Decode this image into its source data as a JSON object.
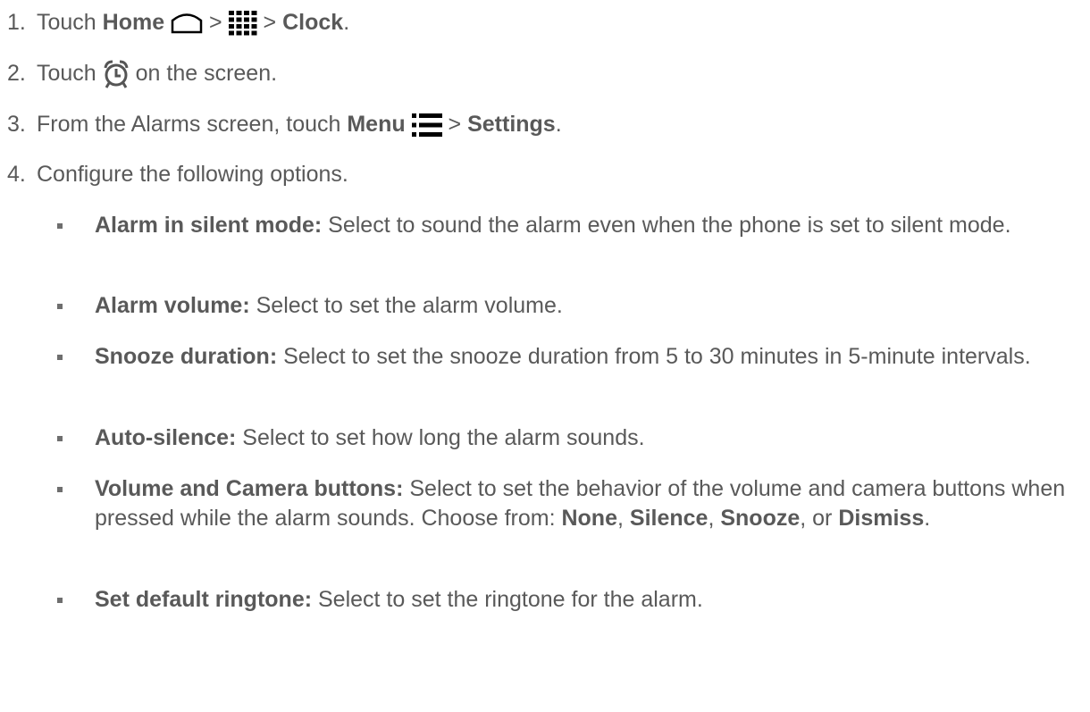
{
  "steps": [
    {
      "num": "1.",
      "pre": "Touch ",
      "home": "Home",
      "sep1": " > ",
      "sep2": " > ",
      "clock": "Clock",
      "end": "."
    },
    {
      "num": "2.",
      "pre": "Touch ",
      "post": " on the screen."
    },
    {
      "num": "3.",
      "pre": "From the Alarms screen, touch ",
      "menu": "Menu",
      "sep": " > ",
      "settings": "Settings",
      "end": "."
    },
    {
      "num": "4.",
      "text": "Configure the following options."
    }
  ],
  "options": [
    {
      "label": "Alarm in silent mode:",
      "desc": " Select to sound the alarm even when the phone is set to silent mode."
    },
    {
      "label": "Alarm volume:",
      "desc": " Select to set the alarm volume."
    },
    {
      "label": "Snooze duration:",
      "desc": " Select to set the snooze duration from 5 to 30 minutes in 5-minute intervals."
    },
    {
      "label": "Auto-silence:",
      "desc": " Select to set how long the alarm sounds."
    },
    {
      "label": "Volume and Camera buttons:",
      "desc": " Select to set the behavior of the volume and camera buttons when pressed while the alarm sounds. Choose from: ",
      "choices": [
        "None",
        "Silence",
        "Snooze",
        "Dismiss"
      ],
      "comma": ", ",
      "or": ", or ",
      "end": "."
    },
    {
      "label": "Set default ringtone:",
      "desc": " Select to set the ringtone for the alarm."
    }
  ],
  "icons": {
    "home": "home-icon",
    "apps": "apps-grid-icon",
    "alarm": "alarm-clock-icon",
    "menu": "menu-icon"
  }
}
